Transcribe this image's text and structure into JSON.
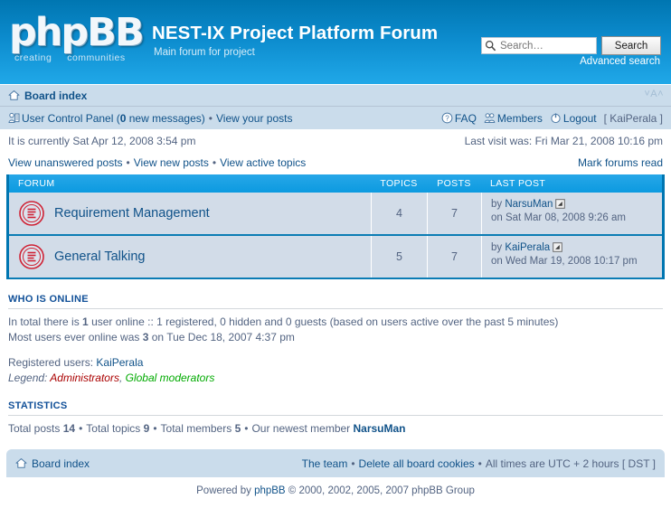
{
  "header": {
    "logo_text": "phpBB",
    "logo_tagline_left": "creating",
    "logo_tagline_right": "communities",
    "site_title": "NEST-IX Project Platform Forum",
    "site_description": "Main forum for project",
    "search_placeholder": "Search…",
    "search_button": "Search",
    "advanced_search": "Advanced search",
    "accent_color": "#0076b1",
    "header_gradient_bottom": "#20a8e8"
  },
  "navbar": {
    "board_index": "Board index",
    "font_size_changer": "˅A˄",
    "ucp_label": "User Control Panel (",
    "ucp_count": "0",
    "ucp_label_end": " new messages)",
    "view_your_posts": "View your posts",
    "faq": "FAQ",
    "members": "Members",
    "logout": "Logout",
    "logout_user": "[ KaiPerala ]",
    "separator": "•"
  },
  "info": {
    "current_time": "It is currently Sat Apr 12, 2008 3:54 pm",
    "last_visit": "Last visit was: Fri Mar 21, 2008 10:16 pm"
  },
  "quicklinks": {
    "unanswered": "View unanswered posts",
    "new_posts": "View new posts",
    "active_topics": "View active topics",
    "mark_read": "Mark forums read"
  },
  "forum_table": {
    "columns": {
      "forum": "FORUM",
      "topics": "TOPICS",
      "posts": "POSTS",
      "last_post": "LAST POST"
    },
    "rows": [
      {
        "name": "Requirement Management",
        "topics": "4",
        "posts": "7",
        "last_post_by_prefix": "by ",
        "last_post_author": "NarsuMan",
        "last_post_date": "on Sat Mar 08, 2008 9:26 am"
      },
      {
        "name": "General Talking",
        "topics": "5",
        "posts": "7",
        "last_post_by_prefix": "by ",
        "last_post_author": "KaiPerala",
        "last_post_date": "on Wed Mar 19, 2008 10:17 pm"
      }
    ]
  },
  "who_is_online": {
    "title": "WHO IS ONLINE",
    "total_prefix": "In total there is ",
    "total_count": "1",
    "total_suffix": " user online :: 1 registered, 0 hidden and 0 guests (based on users active over the past 5 minutes)",
    "record_prefix": "Most users ever online was ",
    "record_count": "3",
    "record_suffix": " on Tue Dec 18, 2007 4:37 pm",
    "registered_label": "Registered users: ",
    "registered_users": "KaiPerala",
    "legend_label": "Legend: ",
    "legend_admins": "Administrators",
    "legend_comma": ", ",
    "legend_gmods": "Global moderators",
    "admin_color": "#aa0000",
    "gmod_color": "#00aa00"
  },
  "statistics": {
    "title": "STATISTICS",
    "total_posts_label": "Total posts ",
    "total_posts": "14",
    "total_topics_label": "Total topics ",
    "total_topics": "9",
    "total_members_label": "Total members ",
    "total_members": "5",
    "newest_label": "Our newest member ",
    "newest_member": "NarsuMan"
  },
  "footer": {
    "board_index": "Board index",
    "the_team": "The team",
    "delete_cookies": "Delete all board cookies",
    "timezone": "All times are UTC + 2 hours [ DST ]",
    "powered_prefix": "Powered by ",
    "powered_brand": "phpBB",
    "powered_suffix": " © 2000, 2002, 2005, 2007 phpBB Group"
  }
}
